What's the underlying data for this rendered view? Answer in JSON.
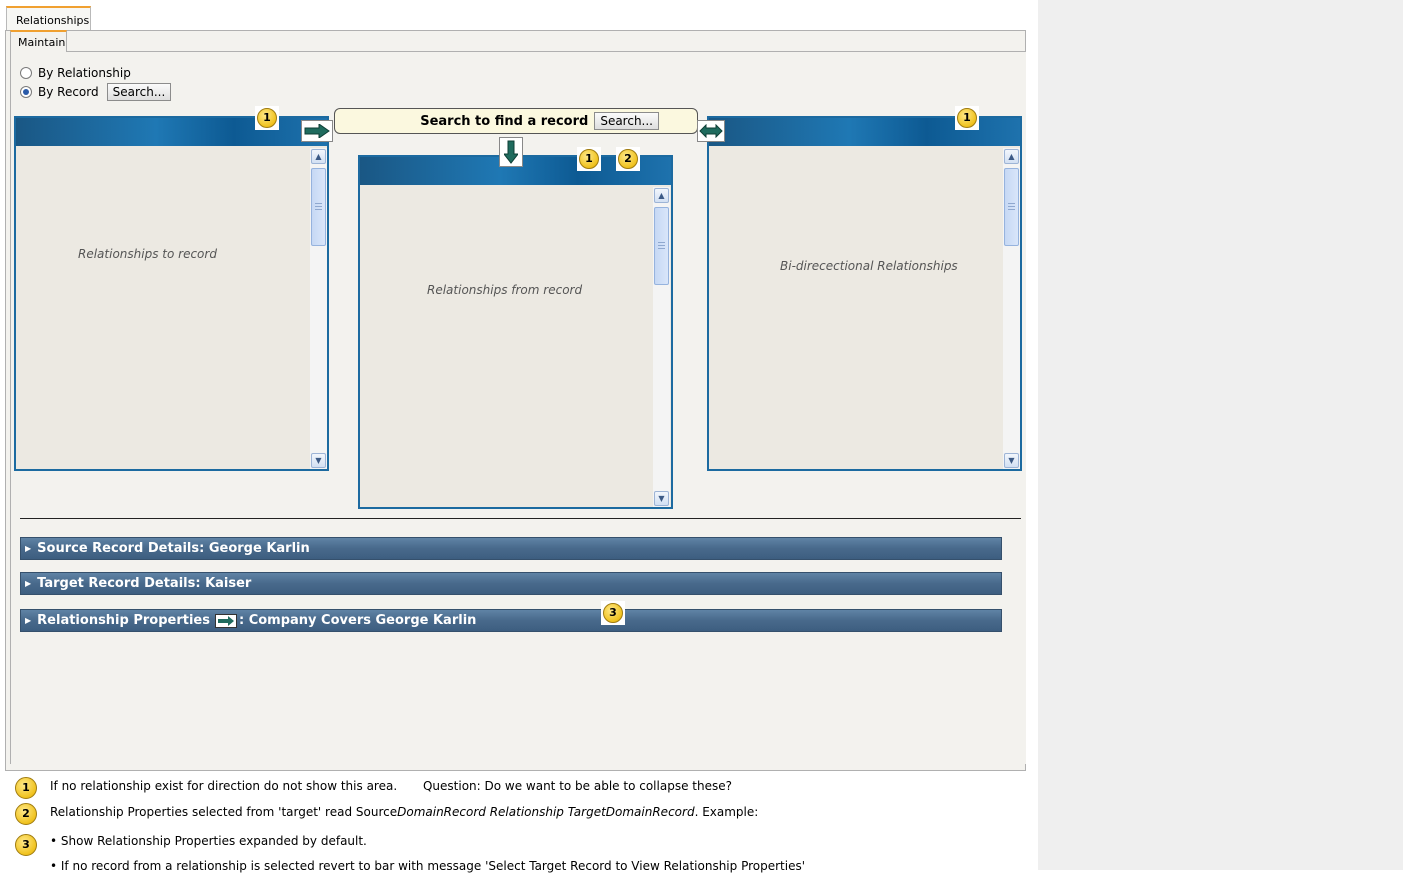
{
  "tabs": {
    "outer": "Relationships",
    "inner": "Maintain"
  },
  "mode": {
    "by_relationship": "By Relationship",
    "by_record": "By Record",
    "selected": "By Record",
    "search_button": "Search..."
  },
  "search_bar": {
    "label": "Search to find a record",
    "button": "Search..."
  },
  "panels": {
    "to_record": "Relationships to record",
    "from_record": "Relationships from record",
    "bidirectional": "Bi-direcectional Relationships"
  },
  "badges": {
    "one": "1",
    "two": "2",
    "three": "3"
  },
  "sections": {
    "source": "Source Record Details: George Karlin",
    "target": "Target Record Details: Kaiser",
    "props_prefix": "Relationship Properties",
    "props_suffix": ": Company Covers George Karlin"
  },
  "notes": {
    "n1_text": "If no relationship exist for direction do not show this area.",
    "n1_question": "Question: Do we want  to be able to collapse these?",
    "n2_a": "Relationship Properties selected from 'target' read  Source",
    "n2_b": "DomainRecord  Relationship TargetDomainRecord",
    "n2_c": ". Example:",
    "n3_a": "• Show Relationship Properties expanded by default.",
    "n3_b": "• If no record from a relationship is selected revert to bar with message 'Select Target Record to View Relationship Properties'"
  },
  "icons": [
    "right-arrow-icon",
    "down-arrow-icon",
    "bidirectional-arrow-icon",
    "expand-triangle-icon",
    "scroll-up-icon",
    "scroll-down-icon"
  ],
  "colors": {
    "panel_blue": "#1f78b4",
    "section_bar": "#48698b",
    "badge": "#f0c21e",
    "tab_accent": "#f0a030"
  }
}
